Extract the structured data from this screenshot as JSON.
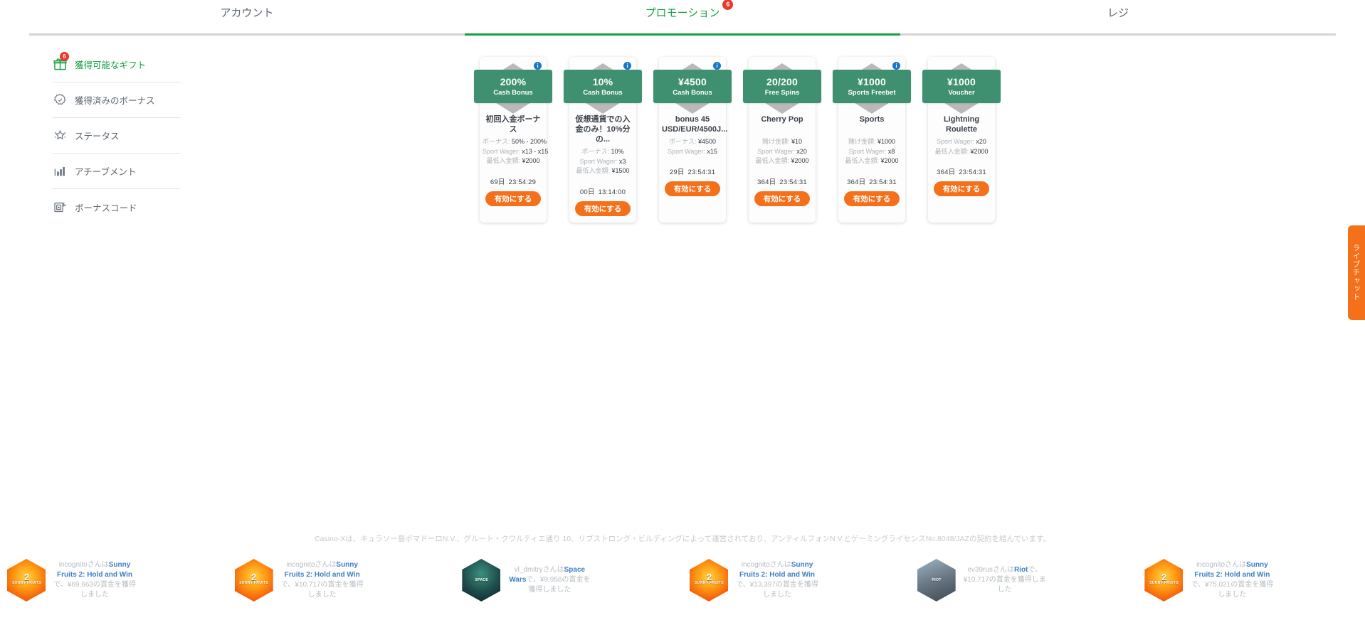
{
  "tabs": [
    {
      "label": "アカウント",
      "active": false,
      "badge": null
    },
    {
      "label": "プロモーション",
      "active": true,
      "badge": "6"
    },
    {
      "label": "レジ",
      "active": false,
      "badge": null
    }
  ],
  "sidebar": {
    "items": [
      {
        "label": "獲得可能なギフト",
        "icon": "gift-icon",
        "active": true,
        "badge": "6"
      },
      {
        "label": "獲得済みのボーナス",
        "icon": "badge-check-icon",
        "active": false,
        "badge": null
      },
      {
        "label": "ステータス",
        "icon": "star-status-icon",
        "active": false,
        "badge": null
      },
      {
        "label": "アチーブメント",
        "icon": "bar-chart-icon",
        "active": false,
        "badge": null
      },
      {
        "label": "ボーナスコード",
        "icon": "bonus-code-icon",
        "active": false,
        "badge": null
      }
    ]
  },
  "promos": {
    "activate_label": "有効にする",
    "info_glyph": "i",
    "cards": [
      {
        "amount": "200%",
        "kind": "Cash Bonus",
        "title": "初回入金ボーナス",
        "has_info": true,
        "rows": [
          {
            "key": "ボーナス:",
            "value": "50% - 200%"
          },
          {
            "key": "Sport Wager:",
            "value": "x13 - x15"
          },
          {
            "key": "最低入金額:",
            "value": "¥2000"
          }
        ],
        "timer_days": "69日",
        "timer_clock": "23:54:29"
      },
      {
        "amount": "10%",
        "kind": "Cash Bonus",
        "title": "仮想通貨での入金のみ！10%分の...",
        "has_info": true,
        "rows": [
          {
            "key": "ボーナス:",
            "value": "10%"
          },
          {
            "key": "Sport Wager:",
            "value": "x3"
          },
          {
            "key": "最低入金額:",
            "value": "¥1500"
          }
        ],
        "timer_days": "00日",
        "timer_clock": "13:14:00"
      },
      {
        "amount": "¥4500",
        "kind": "Cash Bonus",
        "title": "bonus 45 USD/EUR/4500J...",
        "has_info": true,
        "rows": [
          {
            "key": "ボーナス:",
            "value": "¥4500"
          },
          {
            "key": "Sport Wager:",
            "value": "x15"
          }
        ],
        "timer_days": "29日",
        "timer_clock": "23:54:31"
      },
      {
        "amount": "20/200",
        "kind": "Free Spins",
        "title": "Cherry Pop",
        "has_info": false,
        "rows": [
          {
            "key": "賭け金額:",
            "value": "¥10"
          },
          {
            "key": "Sport Wager:",
            "value": "x20"
          },
          {
            "key": "最低入金額:",
            "value": "¥2000"
          }
        ],
        "timer_days": "364日",
        "timer_clock": "23:54:31"
      },
      {
        "amount": "¥1000",
        "kind": "Sports Freebet",
        "title": "Sports",
        "has_info": true,
        "rows": [
          {
            "key": "賭け金額:",
            "value": "¥1000"
          },
          {
            "key": "Sport Wager:",
            "value": "x8"
          },
          {
            "key": "最低入金額:",
            "value": "¥2000"
          }
        ],
        "timer_days": "364日",
        "timer_clock": "23:54:31"
      },
      {
        "amount": "¥1000",
        "kind": "Voucher",
        "title": "Lightning Roulette",
        "has_info": false,
        "rows": [
          {
            "key": "Sport Wager:",
            "value": "x20"
          },
          {
            "key": "最低入金額:",
            "value": "¥2000"
          }
        ],
        "timer_days": "364日",
        "timer_clock": "23:54:31"
      }
    ]
  },
  "livechat": {
    "label": "ライブチャット"
  },
  "legal": {
    "text": "Casino-Xは、キュラソー島ポマドーロN.V.、グルート・クワルティエ通り 10、リブストロング・ビルディングによって運営されており、アンティルフォンN.V.とゲーミングライセンスNo.8048/JAZの契約を結んでいます。"
  },
  "winners": [
    {
      "user": "incognito",
      "connector": "さんは",
      "game": "Sunny Fruits 2: Hold and Win",
      "tail": "で、¥69,663の賞金を獲得しました",
      "thumb": "sunny-fruits-thumb",
      "thumb_class": "th-sunny",
      "thumb_big": "2",
      "thumb_sm": "SUNNY FRUITS"
    },
    {
      "user": "incognito",
      "connector": "さんは",
      "game": "Sunny Fruits 2: Hold and Win",
      "tail": "で、¥10,717の賞金を獲得しました",
      "thumb": "sunny-fruits-thumb",
      "thumb_class": "th-sunny",
      "thumb_big": "2",
      "thumb_sm": "SUNNY FRUITS"
    },
    {
      "user": "vl_dmitry",
      "connector": "さんは",
      "game": "Space Wars",
      "tail": "で、¥9,958の賞金を獲得しました",
      "thumb": "space-wars-thumb",
      "thumb_class": "th-space",
      "thumb_big": "",
      "thumb_sm": "SPACE"
    },
    {
      "user": "incognito",
      "connector": "さんは",
      "game": "Sunny Fruits 2: Hold and Win",
      "tail": "で、¥13,397の賞金を獲得しました",
      "thumb": "sunny-fruits-thumb",
      "thumb_class": "th-sunny",
      "thumb_big": "2",
      "thumb_sm": "SUNNY FRUITS"
    },
    {
      "user": "ev39rus",
      "connector": "さんは",
      "game": "Riot",
      "tail": "で、¥10,717の賞金を獲得しました",
      "thumb": "riot-thumb",
      "thumb_class": "th-riot",
      "thumb_big": "",
      "thumb_sm": "RIOT"
    },
    {
      "user": "incognito",
      "connector": "さんは",
      "game": "Sunny Fruits 2: Hold and Win",
      "tail": "で、¥75,021の賞金を獲得しました",
      "thumb": "sunny-fruits-thumb",
      "thumb_class": "th-sunny",
      "thumb_big": "2",
      "thumb_sm": "SUNNY FRUITS"
    }
  ],
  "colors": {
    "accent_green": "#15a043",
    "ribbon_green": "#3e9070",
    "orange": "#f4701b",
    "badge_red": "#e8392b",
    "info_blue": "#1976c4"
  }
}
